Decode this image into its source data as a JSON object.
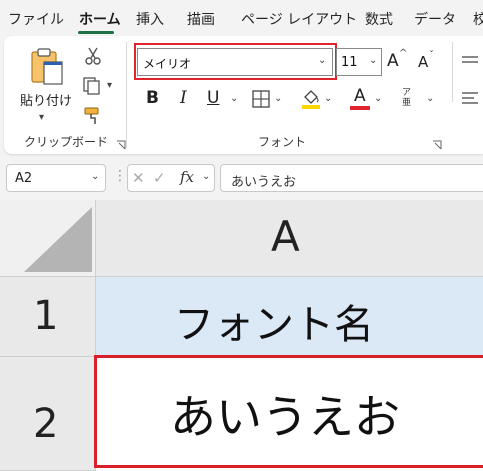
{
  "tabs": [
    "ファイル",
    "ホーム",
    "挿入",
    "描画",
    "ページ レイアウト",
    "数式",
    "データ",
    "校"
  ],
  "active_tab": "ホーム",
  "ribbon": {
    "clipboard": {
      "paste_label": "貼り付け",
      "group_label": "クリップボード"
    },
    "font": {
      "font_name": "メイリオ",
      "font_size": "11",
      "bold": "B",
      "italic": "I",
      "underline": "U",
      "font_color_letter": "A",
      "grow_font": "A",
      "shrink_font": "A",
      "phonetic_small": "ア亜",
      "group_label": "フォント"
    },
    "colors": {
      "accent_green": "#1e7145",
      "highlight_red": "#e0242d",
      "fill_yellow": "#ffd500",
      "font_red": "#e0242d"
    }
  },
  "formula_bar": {
    "name_box": "A2",
    "fx_label": "fx",
    "formula": "あいうえお"
  },
  "sheet": {
    "column_header": "A",
    "rows": [
      {
        "label": "1",
        "value": "フォント名"
      },
      {
        "label": "2",
        "value": "あいうえお"
      }
    ],
    "selected_cell_fill": "#dbe8f6"
  }
}
